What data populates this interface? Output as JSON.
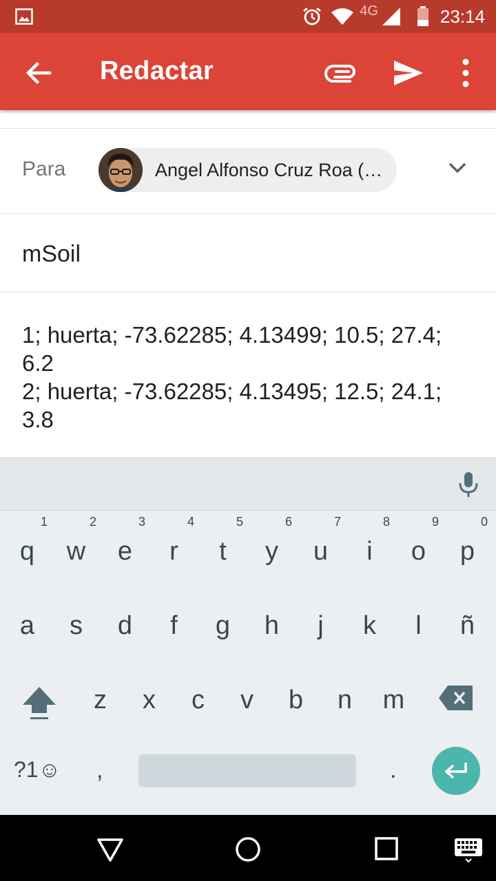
{
  "status_bar": {
    "network": "4G",
    "time": "23:14"
  },
  "app_bar": {
    "title": "Redactar"
  },
  "compose": {
    "to_label": "Para",
    "recipient": "Angel Alfonso Cruz Roa (…",
    "subject": "mSoil",
    "body_lines": [
      "1; huerta; -73.62285; 4.13499; 10.5; 27.4;",
      "6.2",
      "2; huerta; -73.62285; 4.13495; 12.5; 24.1;",
      "3.8"
    ]
  },
  "keyboard": {
    "row1": [
      {
        "k": "q",
        "n": "1"
      },
      {
        "k": "w",
        "n": "2"
      },
      {
        "k": "e",
        "n": "3"
      },
      {
        "k": "r",
        "n": "4"
      },
      {
        "k": "t",
        "n": "5"
      },
      {
        "k": "y",
        "n": "6"
      },
      {
        "k": "u",
        "n": "7"
      },
      {
        "k": "i",
        "n": "8"
      },
      {
        "k": "o",
        "n": "9"
      },
      {
        "k": "p",
        "n": "0"
      }
    ],
    "row2": [
      "a",
      "s",
      "d",
      "f",
      "g",
      "h",
      "j",
      "k",
      "l",
      "ñ"
    ],
    "row3": [
      "z",
      "x",
      "c",
      "v",
      "b",
      "n",
      "m"
    ],
    "symbols_label": "?1",
    "comma": ",",
    "period": "."
  },
  "colors": {
    "status_bar": "#b83a2b",
    "app_bar": "#db4437",
    "enter_key": "#4db6ac"
  }
}
